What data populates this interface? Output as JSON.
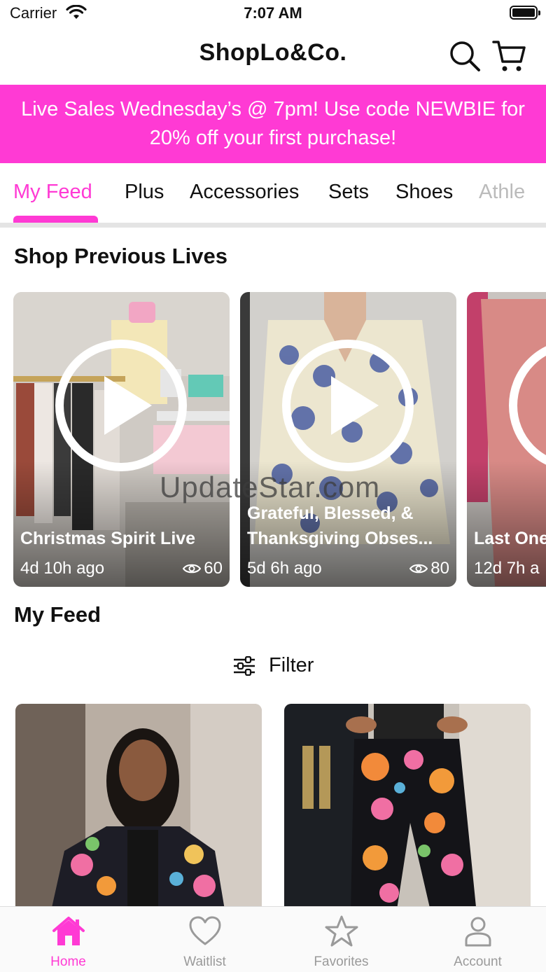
{
  "status_bar": {
    "carrier": "Carrier",
    "time": "7:07 AM"
  },
  "header": {
    "brand": "ShopLo&Co."
  },
  "promo": {
    "line1": "Live Sales Wednesday’s @ 7pm! Use code NEWBIE for",
    "line2": "20% off your first purchase!"
  },
  "accent_color": "#ff3ad4",
  "tabs": [
    {
      "label": "My Feed",
      "active": true
    },
    {
      "label": "Plus"
    },
    {
      "label": "Accessories"
    },
    {
      "label": "Sets"
    },
    {
      "label": "Shoes"
    },
    {
      "label": "Athle"
    }
  ],
  "previous_lives": {
    "title": "Shop Previous Lives",
    "items": [
      {
        "title": "Christmas Spirit Live",
        "ago": "4d 10h ago",
        "views": "60"
      },
      {
        "title_line1": "Grateful, Blessed, &",
        "title_line2": "Thanksgiving Obses...",
        "ago": "5d 6h ago",
        "views": "80"
      },
      {
        "title": "Last One",
        "ago": "12d 7h a"
      }
    ]
  },
  "watermark": "UpdateStar.com",
  "feed": {
    "title": "My Feed",
    "filter_label": "Filter"
  },
  "bottom_nav": [
    {
      "label": "Home",
      "icon": "home-icon",
      "active": true
    },
    {
      "label": "Waitlist",
      "icon": "heart-icon"
    },
    {
      "label": "Favorites",
      "icon": "star-icon"
    },
    {
      "label": "Account",
      "icon": "person-icon"
    }
  ]
}
